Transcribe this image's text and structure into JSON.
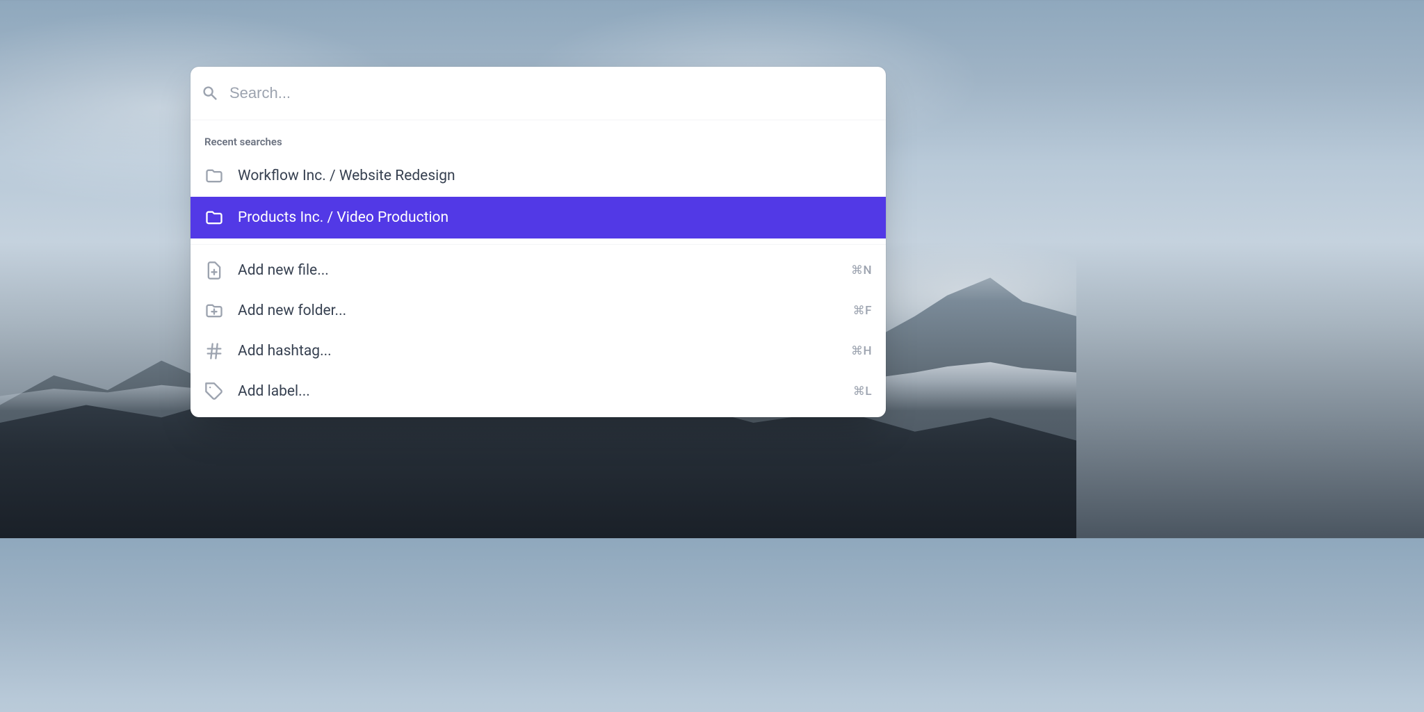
{
  "search": {
    "placeholder": "Search...",
    "value": ""
  },
  "recent": {
    "heading": "Recent searches",
    "items": [
      {
        "label": "Workflow Inc. / Website Redesign",
        "selected": false
      },
      {
        "label": "Products Inc. / Video Production",
        "selected": true
      }
    ]
  },
  "actions": {
    "items": [
      {
        "label": "Add new file...",
        "shortcut": "⌘N",
        "icon": "document-add"
      },
      {
        "label": "Add new folder...",
        "shortcut": "⌘F",
        "icon": "folder-add"
      },
      {
        "label": "Add hashtag...",
        "shortcut": "⌘H",
        "icon": "hashtag"
      },
      {
        "label": "Add label...",
        "shortcut": "⌘L",
        "icon": "tag"
      }
    ]
  },
  "colors": {
    "accent": "#5239e6"
  }
}
